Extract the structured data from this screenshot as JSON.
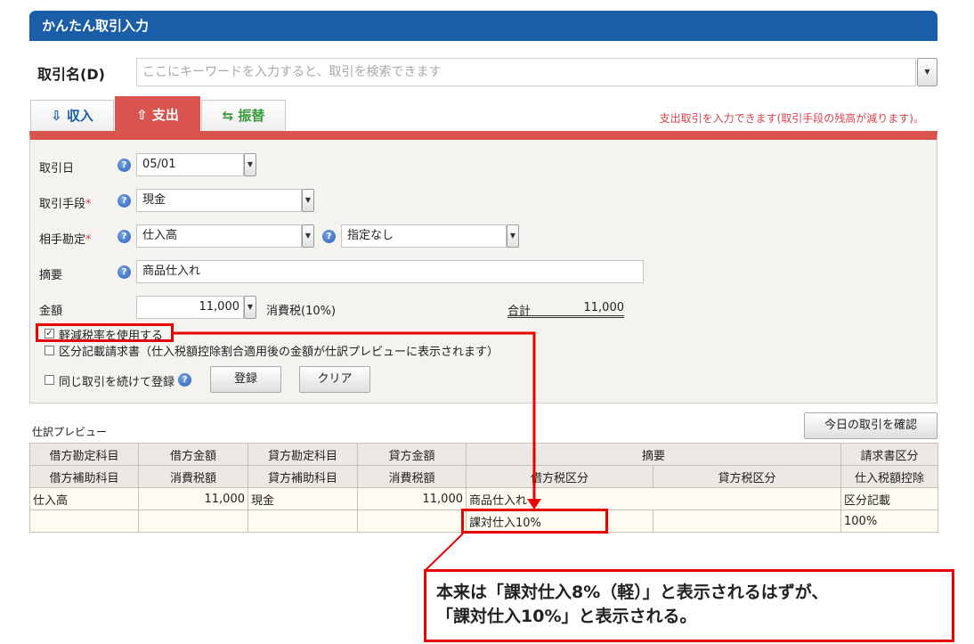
{
  "header": {
    "title": "かんたん取引入力"
  },
  "search": {
    "label": "取引名(D)",
    "placeholder": "ここにキーワードを入力すると、取引を検索できます"
  },
  "tabs": [
    {
      "label": "収入",
      "icon": "income-icon",
      "active": false
    },
    {
      "label": "支出",
      "icon": "expense-icon",
      "active": true
    },
    {
      "label": "振替",
      "icon": "transfer-icon",
      "active": false
    }
  ],
  "tab_note": "支出取引を入力できます(取引手段の残高が減ります)。",
  "form": {
    "date_label": "取引日",
    "date_value": "05/01",
    "method_label": "取引手段",
    "method_value": "現金",
    "account_label": "相手勘定",
    "account_value": "仕入高",
    "sub_account_value": "指定なし",
    "memo_label": "摘要",
    "memo_value": "商品仕入れ",
    "amount_label": "金額",
    "amount_value": "11,000",
    "tax_text": "消費税(10%)",
    "total_label": "合計",
    "total_value": "11,000",
    "required_mark": "*",
    "help_mark": "?",
    "reduced_rate_label": "軽減税率を使用する",
    "reduced_rate_checked": true,
    "invoice_label": "区分記載請求書（仕入税額控除割合適用後の金額が仕訳プレビューに表示されます）",
    "repeat_label": "同じ取引を続けて登録",
    "register_button": "登録",
    "clear_button": "クリア",
    "check_mark": "✓"
  },
  "preview": {
    "title": "仕訳プレビュー",
    "today_button": "今日の取引を確認",
    "header_row1": [
      "借方勘定科目",
      "借方金額",
      "貸方勘定科目",
      "貸方金額",
      "摘要",
      "請求書区分"
    ],
    "header_row2": [
      "借方補助科目",
      "消費税額",
      "貸方補助科目",
      "消費税額",
      "借方税区分",
      "貸方税区分",
      "仕入税額控除"
    ],
    "row1": [
      "仕入高",
      "11,000",
      "現金",
      "11,000",
      "商品仕入れ",
      "区分記載"
    ],
    "row2": [
      "",
      "",
      "",
      "",
      "課対仕入10%",
      "",
      "",
      "100%"
    ]
  },
  "annotation": {
    "line1": "本来は「課対仕入8%（軽）」と表示されるはずが、",
    "line2": "「課対仕入10%」と表示される。",
    "color": "#e60000"
  },
  "colors": {
    "header_blue": "#1a5ea8",
    "expense_red": "#d9534f",
    "income_blue": "#1a5ea8",
    "transfer_green": "#3a9a3a"
  }
}
